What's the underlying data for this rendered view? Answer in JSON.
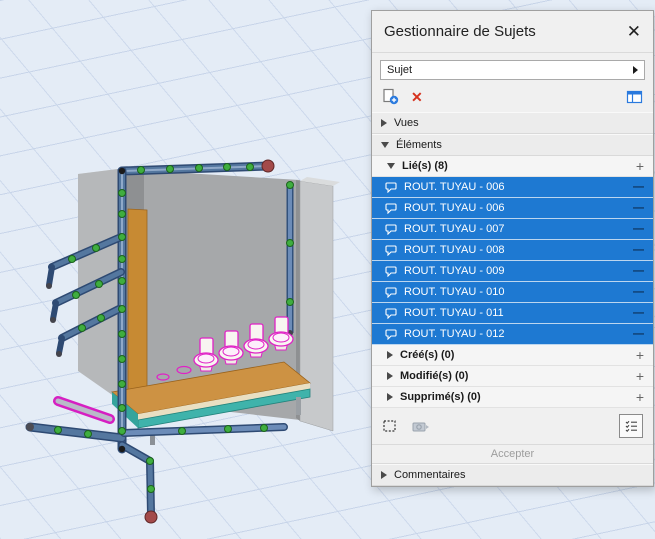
{
  "panel": {
    "title": "Gestionnaire de Sujets",
    "filter_value": "Sujet",
    "icons": {
      "close": "✕",
      "delete": "✕",
      "plus": "+",
      "minus": "—"
    },
    "sections": {
      "vues": "Vues",
      "elements": "Éléments",
      "linked": "Lié(s) (8)",
      "created": "Créé(s) (0)",
      "modified": "Modifié(s) (0)",
      "deleted": "Supprimé(s) (0)",
      "comments": "Commentaires"
    },
    "linked_items": [
      "ROUT. TUYAU - 006",
      "ROUT. TUYAU - 006",
      "ROUT. TUYAU - 007",
      "ROUT. TUYAU - 008",
      "ROUT. TUYAU - 009",
      "ROUT. TUYAU - 010",
      "ROUT. TUYAU - 011",
      "ROUT. TUYAU - 012"
    ],
    "accept_label": "Accepter",
    "colors": {
      "selection": "#1e79d2",
      "delete_red": "#d6321e",
      "accent_blue": "#2a7ade",
      "highlight_magenta": "#e021c6"
    }
  },
  "viewport": {
    "bg": "#e4ecf6",
    "grid_line": "#c8d5e9"
  }
}
